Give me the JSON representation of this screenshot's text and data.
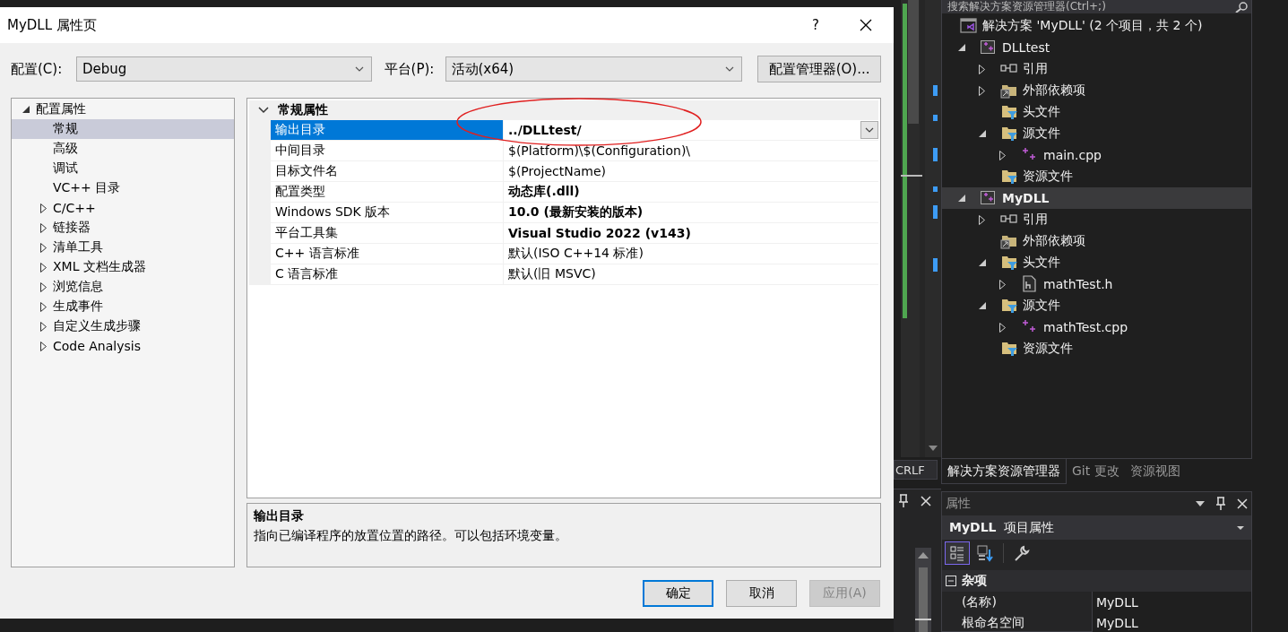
{
  "dialog": {
    "title": "MyDLL 属性页",
    "help_button": "?",
    "configuration": {
      "label": "配置(C):",
      "value": "Debug"
    },
    "platform": {
      "label": "平台(P):",
      "value": "活动(x64)"
    },
    "configuration_manager_button": "配置管理器(O)...",
    "tree": [
      {
        "label": "配置属性",
        "kind": "group",
        "expanded": true,
        "selected": false,
        "children": [
          {
            "label": "常规",
            "kind": "page",
            "selected": true
          },
          {
            "label": "高级",
            "kind": "page",
            "selected": false
          },
          {
            "label": "调试",
            "kind": "page",
            "selected": false
          },
          {
            "label": "VC++ 目录",
            "kind": "page",
            "selected": false
          },
          {
            "label": "C/C++",
            "kind": "group",
            "expanded": false,
            "selected": false
          },
          {
            "label": "链接器",
            "kind": "group",
            "expanded": false,
            "selected": false
          },
          {
            "label": "清单工具",
            "kind": "group",
            "expanded": false,
            "selected": false
          },
          {
            "label": "XML 文档生成器",
            "kind": "group",
            "expanded": false,
            "selected": false
          },
          {
            "label": "浏览信息",
            "kind": "group",
            "expanded": false,
            "selected": false
          },
          {
            "label": "生成事件",
            "kind": "group",
            "expanded": false,
            "selected": false
          },
          {
            "label": "自定义生成步骤",
            "kind": "group",
            "expanded": false,
            "selected": false
          },
          {
            "label": "Code Analysis",
            "kind": "group",
            "expanded": false,
            "selected": false
          }
        ]
      }
    ],
    "grid": {
      "category": "常规属性",
      "expanded": true,
      "rows": [
        {
          "name": "输出目录",
          "value": "../DLLtest/",
          "bold": true,
          "selected": true
        },
        {
          "name": "中间目录",
          "value": "$(Platform)\\$(Configuration)\\",
          "bold": false,
          "selected": false
        },
        {
          "name": "目标文件名",
          "value": "$(ProjectName)",
          "bold": false,
          "selected": false
        },
        {
          "name": "配置类型",
          "value": "动态库(.dll)",
          "bold": true,
          "selected": false
        },
        {
          "name": "Windows SDK 版本",
          "value": "10.0 (最新安装的版本)",
          "bold": true,
          "selected": false
        },
        {
          "name": "平台工具集",
          "value": "Visual Studio 2022 (v143)",
          "bold": true,
          "selected": false
        },
        {
          "name": "C++ 语言标准",
          "value": "默认(ISO C++14 标准)",
          "bold": false,
          "selected": false
        },
        {
          "name": "C 语言标准",
          "value": "默认(旧 MSVC)",
          "bold": false,
          "selected": false
        }
      ]
    },
    "description": {
      "title": "输出目录",
      "text": "指向已编译程序的放置位置的路径。可以包括环境变量。"
    },
    "buttons": [
      {
        "label": "确定",
        "default": true,
        "disabled": false
      },
      {
        "label": "取消",
        "default": false,
        "disabled": false
      },
      {
        "label": "应用(A)",
        "default": false,
        "disabled": true
      }
    ]
  },
  "editor": {
    "line_ending": "CRLF"
  },
  "solution_explorer": {
    "search_placeholder": "搜索解决方案资源管理器(Ctrl+;)",
    "tree": [
      {
        "label": "解决方案 'MyDLL' (2 个项目，共 2 个)",
        "kind": "solution",
        "selected": false,
        "children": [
          {
            "label": "DLLtest",
            "kind": "project",
            "expandable": true,
            "expanded": true,
            "selected": false,
            "children": [
              {
                "label": "引用",
                "kind": "references",
                "expandable": true,
                "expanded": false,
                "selected": false
              },
              {
                "label": "外部依赖项",
                "kind": "external",
                "expandable": true,
                "expanded": false,
                "selected": false
              },
              {
                "label": "头文件",
                "kind": "filter",
                "expandable": false,
                "expanded": false,
                "selected": false
              },
              {
                "label": "源文件",
                "kind": "filter",
                "expandable": true,
                "expanded": true,
                "selected": false,
                "children": [
                  {
                    "label": "main.cpp",
                    "kind": "cpp",
                    "expandable": true,
                    "expanded": false,
                    "selected": false
                  }
                ]
              },
              {
                "label": "资源文件",
                "kind": "filter",
                "expandable": false,
                "expanded": false,
                "selected": false
              }
            ]
          },
          {
            "label": "MyDLL",
            "kind": "project",
            "expandable": true,
            "expanded": true,
            "selected": true,
            "children": [
              {
                "label": "引用",
                "kind": "references",
                "expandable": true,
                "expanded": false,
                "selected": false
              },
              {
                "label": "外部依赖项",
                "kind": "external",
                "expandable": false,
                "expanded": false,
                "selected": false
              },
              {
                "label": "头文件",
                "kind": "filter",
                "expandable": true,
                "expanded": true,
                "selected": false,
                "children": [
                  {
                    "label": "mathTest.h",
                    "kind": "header",
                    "expandable": true,
                    "expanded": false,
                    "selected": false
                  }
                ]
              },
              {
                "label": "源文件",
                "kind": "filter",
                "expandable": true,
                "expanded": true,
                "selected": false,
                "children": [
                  {
                    "label": "mathTest.cpp",
                    "kind": "cpp",
                    "expandable": true,
                    "expanded": false,
                    "selected": false
                  }
                ]
              },
              {
                "label": "资源文件",
                "kind": "filter",
                "expandable": false,
                "expanded": false,
                "selected": false
              }
            ]
          }
        ]
      }
    ],
    "tabs": [
      {
        "label": "解决方案资源管理器",
        "selected": true
      },
      {
        "label": "Git 更改",
        "selected": false
      },
      {
        "label": "资源视图",
        "selected": false
      }
    ]
  },
  "properties": {
    "title": "属性",
    "object_name": "MyDLL",
    "object_type": "项目属性",
    "toolbar": [
      {
        "kind": "categorized",
        "selected": true
      },
      {
        "kind": "alphabetical",
        "selected": false
      },
      {
        "kind": "property-pages",
        "selected": false
      }
    ],
    "category": "杂项",
    "expanded": true,
    "rows": [
      {
        "name": "(名称)",
        "value": "MyDLL"
      },
      {
        "name": "根命名空间",
        "value": "MyDLL"
      }
    ]
  }
}
